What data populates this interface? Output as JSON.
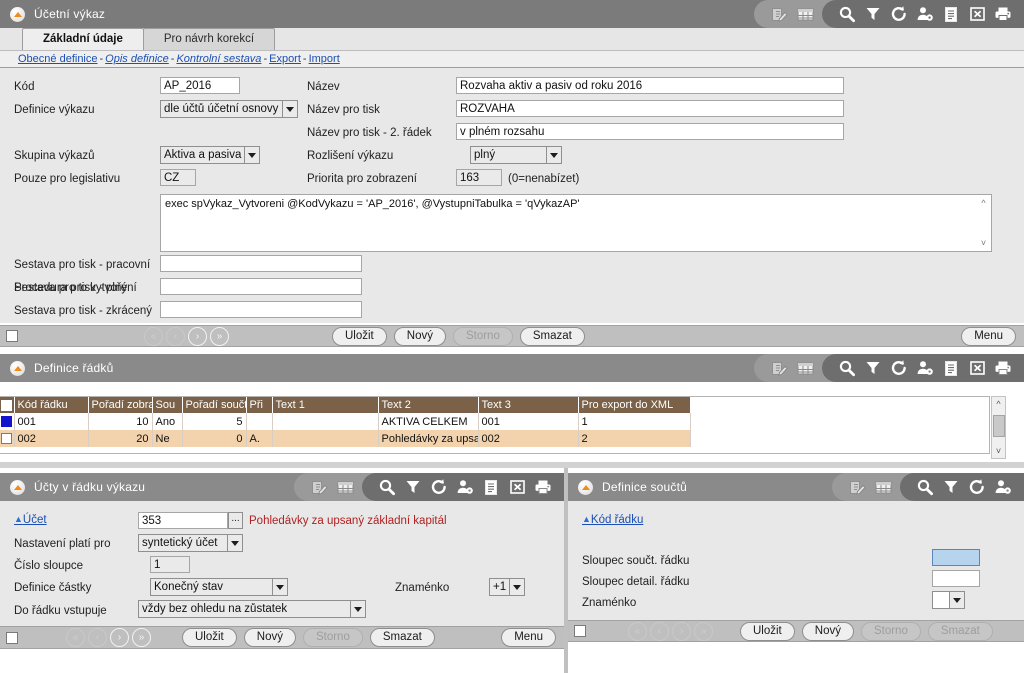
{
  "main_window": {
    "title": "Účetní výkaz",
    "toolbar_icons": [
      "edit-icon",
      "table-icon",
      "search-icon",
      "filter-icon",
      "refresh-icon",
      "user-settings-icon",
      "document-icon",
      "excel-export-icon",
      "print-icon"
    ],
    "tabs": [
      {
        "label": "Základní údaje",
        "active": true
      },
      {
        "label": "Pro návrh korekcí",
        "active": false
      }
    ],
    "links": [
      {
        "label": "Obecné definice",
        "italic": false
      },
      {
        "label": "Opis definice",
        "italic": true
      },
      {
        "label": "Kontrolní sestava",
        "italic": true
      },
      {
        "label": "Export",
        "italic": false
      },
      {
        "label": "Import",
        "italic": false
      }
    ],
    "separator": "-",
    "form": {
      "kod_label": "Kód",
      "kod_value": "AP_2016",
      "definice_vykazu_label": "Definice výkazu",
      "definice_vykazu_value": "dle účtů účetní osnovy",
      "skupina_vykazu_label": "Skupina výkazů",
      "skupina_vykazu_value": "Aktiva a pasiva",
      "legislativa_label": "Pouze pro legislativu",
      "legislativa_value": "CZ",
      "nazev_label": "Název",
      "nazev_value": "Rozvaha aktiv a pasiv od roku 2016",
      "nazev_tisk_label": "Název pro tisk",
      "nazev_tisk_value": "ROZVAHA",
      "nazev_tisk2_label": "Název pro tisk - 2. řádek",
      "nazev_tisk2_value": "v plném rozsahu",
      "rozliseni_label": "Rozlišení výkazu",
      "rozliseni_value": "plný",
      "priorita_label": "Priorita pro zobrazení",
      "priorita_value": "163",
      "priorita_hint": "(0=nenabízet)",
      "procedura_label": "Procedura pro vytvoření",
      "procedura_value": "exec spVykaz_Vytvoreni @KodVykazu = 'AP_2016', @VystupniTabulka = 'qVykazAP'",
      "sestava_pracovni_label": "Sestava pro tisk - pracovní",
      "sestava_pracovni_value": "",
      "sestava_plny_label": "Sestava pro tisk - plný",
      "sestava_plny_value": "",
      "sestava_zkraceny_label": "Sestava pro tisk - zkrácený",
      "sestava_zkraceny_value": ""
    },
    "buttons": {
      "save": "Uložit",
      "new": "Nový",
      "cancel": "Storno",
      "delete": "Smazat",
      "menu": "Menu"
    },
    "nav": {
      "first": "«",
      "prev": "‹",
      "next": "›",
      "last": "»"
    }
  },
  "rows_panel": {
    "title": "Definice řádků",
    "toolbar_icons": [
      "edit-icon",
      "table-icon",
      "search-icon",
      "filter-icon",
      "refresh-icon",
      "user-settings-icon",
      "document-icon",
      "excel-export-icon",
      "print-icon"
    ],
    "grid": {
      "columns": [
        "Kód řádku",
        "Pořadí zobra",
        "Sou",
        "Pořadí součt",
        "Při",
        "Text 1",
        "Text 2",
        "Text 3",
        "Pro export do XML"
      ],
      "rows": [
        {
          "selected": true,
          "kod_radku": "001",
          "poradi_zobrazeni": "10",
          "sou": "Ano",
          "poradi_souctu": "5",
          "pri": "",
          "text1": "",
          "text2": "AKTIVA CELKEM",
          "text3": "001",
          "xml": "1"
        },
        {
          "selected": false,
          "kod_radku": "002",
          "poradi_zobrazeni": "20",
          "sou": "Ne",
          "poradi_souctu": "0",
          "pri": "A.",
          "text1": "",
          "text2": "Pohledávky za upsa",
          "text3": "002",
          "xml": "2"
        }
      ]
    }
  },
  "accounts_panel": {
    "title": "Účty v řádku výkazu",
    "toolbar_icons": [
      "edit-icon",
      "table-icon",
      "search-icon",
      "filter-icon",
      "refresh-icon",
      "user-settings-icon",
      "document-icon",
      "excel-export-icon",
      "print-icon"
    ],
    "form": {
      "ucet_label": "Účet",
      "ucet_value": "353",
      "ucet_ellipsis": "...",
      "ucet_desc": "Pohledávky za upsaný základní kapitál",
      "nastaveni_label": "Nastavení platí pro",
      "nastaveni_value": "syntetický účet",
      "cislo_sloupce_label": "Číslo sloupce",
      "cislo_sloupce_value": "1",
      "definice_castky_label": "Definice částky",
      "definice_castky_value": "Konečný stav",
      "znamenko_label": "Znaménko",
      "znamenko_value": "+1",
      "do_radku_label": "Do řádku vstupuje",
      "do_radku_value": "vždy bez ohledu na zůstatek"
    },
    "buttons": {
      "save": "Uložit",
      "new": "Nový",
      "cancel": "Storno",
      "delete": "Smazat",
      "menu": "Menu"
    },
    "nav": {
      "first": "«",
      "prev": "‹",
      "next": "›",
      "last": "»"
    }
  },
  "sums_panel": {
    "title": "Definice součtů",
    "toolbar_icons": [
      "edit-icon",
      "table-icon",
      "search-icon",
      "filter-icon",
      "refresh-icon",
      "user-settings-icon"
    ],
    "form": {
      "kod_radku_label": "Kód řádku",
      "sloupec_souct_label": "Sloupec součt. řádku",
      "sloupec_souct_value": "",
      "sloupec_detail_label": "Sloupec detail. řádku",
      "sloupec_detail_value": "",
      "znamenko_label": "Znaménko",
      "znamenko_value": ""
    },
    "buttons": {
      "save": "Uložit",
      "new": "Nový",
      "cancel": "Storno",
      "delete": "Smazat"
    },
    "nav": {
      "first": "«",
      "prev": "‹",
      "next": "›",
      "last": "»"
    }
  },
  "colors": {
    "titlebar": "#7b7b7b",
    "panel_bg": "#e8e8e8",
    "grid_header": "#7a6147",
    "grid_alt_row": "#f2d3ae",
    "link": "#1b4fb4",
    "accent_red": "#b32020",
    "orb_accent": "#f08a18",
    "selection": "#1414cf",
    "focus_field": "#b6d4ee"
  }
}
